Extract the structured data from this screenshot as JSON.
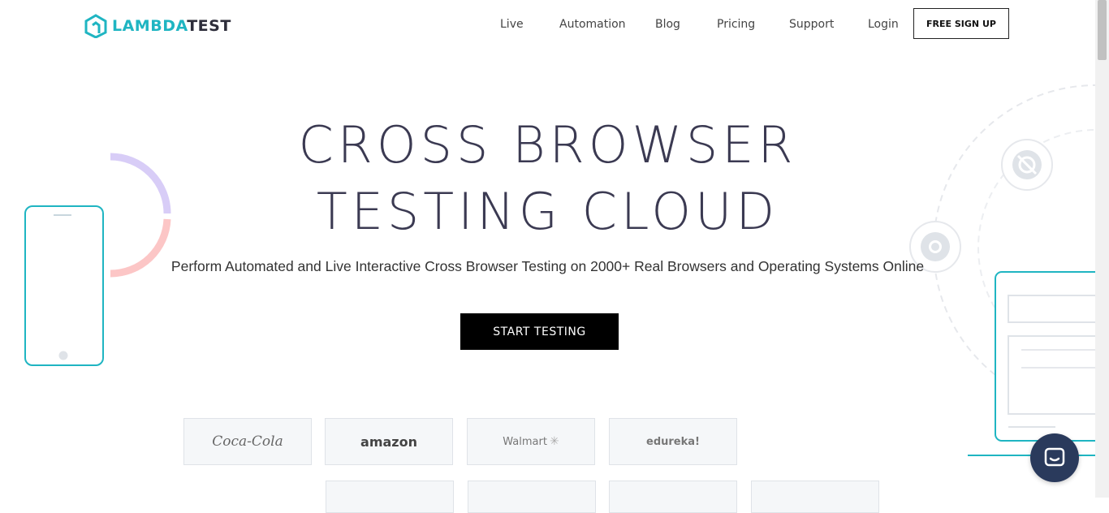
{
  "header": {
    "logo_lambda": "LAMBDA",
    "logo_test": "TEST",
    "nav": [
      "Live",
      "Automation",
      "Blog",
      "Pricing",
      "Support",
      "Login"
    ],
    "signup_label": "FREE SIGN UP"
  },
  "hero": {
    "title_line1": "CROSS BROWSER",
    "title_line2": "TESTING CLOUD",
    "subtitle": "Perform Automated and Live Interactive Cross Browser Testing on 2000+ Real Browsers and Operating Systems Online",
    "cta_label": "START TESTING"
  },
  "brands": [
    "Coca-Cola",
    "amazon",
    "Walmart",
    "edureka!"
  ],
  "colors": {
    "accent": "#1fb5c2",
    "title": "#3b3a52",
    "cta_bg": "#000000",
    "chat_bg": "#2a3a5c"
  },
  "icons": [
    "logo-icon",
    "chat-icon",
    "safari-icon",
    "chrome-icon"
  ]
}
